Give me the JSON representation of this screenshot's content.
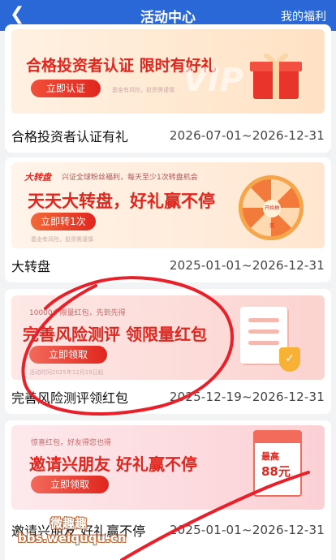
{
  "header": {
    "title": "活动中心",
    "back_icon": "chevron-left-icon",
    "right_link": "我的福利"
  },
  "activities": [
    {
      "name": "合格投资者认证有礼",
      "date": "2026-07-01~2026-12-31",
      "banner": {
        "title": "合格投资者认证 限时有好礼",
        "button": "立即认证",
        "small": "基金有风险，投资需谨慎",
        "watermark_text": "VIP"
      }
    },
    {
      "name": "大转盘",
      "date": "2025-01-01~2026-12-31",
      "banner": {
        "brand": "大转盘",
        "subtitle": "兴证全球粉丝福利，每天至少1次转盘机会",
        "title": "天天大转盘，好礼赢不停",
        "button": "立即转1次",
        "small": "基金有风险，投资需谨慎",
        "wheel_center": "开始抽奖"
      }
    },
    {
      "name": "完善风险测评领红包",
      "date": "2025-12-19~2026-12-31",
      "banner": {
        "subtitle": "10000个限量红包，先到先得",
        "title": "完善风险测评 领限量红包",
        "button": "立即领取",
        "small": "活动时间2025年12月19日起"
      }
    },
    {
      "name": "邀请兴朋友 好礼赢不停",
      "date": "2025-01-01~2026-12-31",
      "banner": {
        "subtitle": "惊喜红包，好友得您也得",
        "title": "邀请兴朋友 好礼赢不停",
        "button": "立即领取",
        "redpack_label": "最高",
        "redpack_amount": "88元"
      }
    }
  ],
  "overlay_watermark": {
    "line1": "微趣趣",
    "line2": "bbs.weiququ.cn"
  },
  "colors": {
    "header_bg": "#2a68d8",
    "accent_red": "#e0261e",
    "scribble": "#e8202a"
  }
}
